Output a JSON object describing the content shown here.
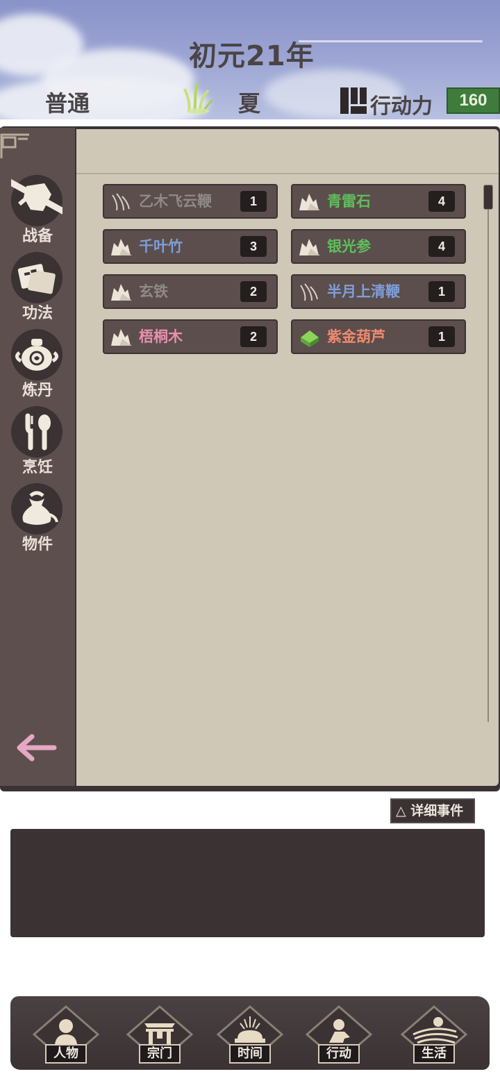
{
  "header": {
    "title": "初元21年",
    "difficulty": "普通",
    "season": "夏",
    "action_points_label": "行动力",
    "action_points_value": "160",
    "icons": [
      "bamboo-grass-icon",
      "action-points-icon"
    ]
  },
  "sidebar": {
    "items": [
      {
        "label": "战备",
        "icon": "sword-shield-icon"
      },
      {
        "label": "功法",
        "icon": "scroll-book-icon"
      },
      {
        "label": "炼丹",
        "icon": "alchemy-cauldron-icon"
      },
      {
        "label": "烹饪",
        "icon": "cooking-utensils-icon"
      },
      {
        "label": "物件",
        "icon": "item-pouch-icon"
      }
    ],
    "back_icon": "back-arrow-icon"
  },
  "inventory": {
    "items": [
      {
        "name": "乙木飞云鞭",
        "count": "1",
        "color": "#8f8a86",
        "icon": "whip-icon"
      },
      {
        "name": "青雷石",
        "count": "4",
        "color": "#5fbf5a",
        "icon": "ore-icon"
      },
      {
        "name": "千叶竹",
        "count": "3",
        "color": "#7f9ed8",
        "icon": "ore-icon"
      },
      {
        "name": "银光参",
        "count": "4",
        "color": "#5fbf5a",
        "icon": "ore-icon"
      },
      {
        "name": "玄铁",
        "count": "2",
        "color": "#8f8a86",
        "icon": "ore-icon"
      },
      {
        "name": "半月上清鞭",
        "count": "1",
        "color": "#7f9ed8",
        "icon": "whip-icon"
      },
      {
        "name": "梧桐木",
        "count": "2",
        "color": "#e88fb0",
        "icon": "ore-icon"
      },
      {
        "name": "紫金葫芦",
        "count": "1",
        "color": "#ef8a6e",
        "icon": "gourd-artifact-icon"
      }
    ]
  },
  "events": {
    "detail_button": "△ 详细事件"
  },
  "nav": {
    "items": [
      {
        "label": "人物",
        "icon": "character-icon"
      },
      {
        "label": "宗门",
        "icon": "sect-gate-icon"
      },
      {
        "label": "时间",
        "icon": "time-incense-icon"
      },
      {
        "label": "行动",
        "icon": "action-icon"
      },
      {
        "label": "生活",
        "icon": "life-landscape-icon"
      }
    ]
  },
  "colors": {
    "panel_dark": "#3a3233",
    "sidebar": "#5e4f4f",
    "content_bg": "#cfc8b7",
    "ap_green": "#3f7c3b"
  }
}
